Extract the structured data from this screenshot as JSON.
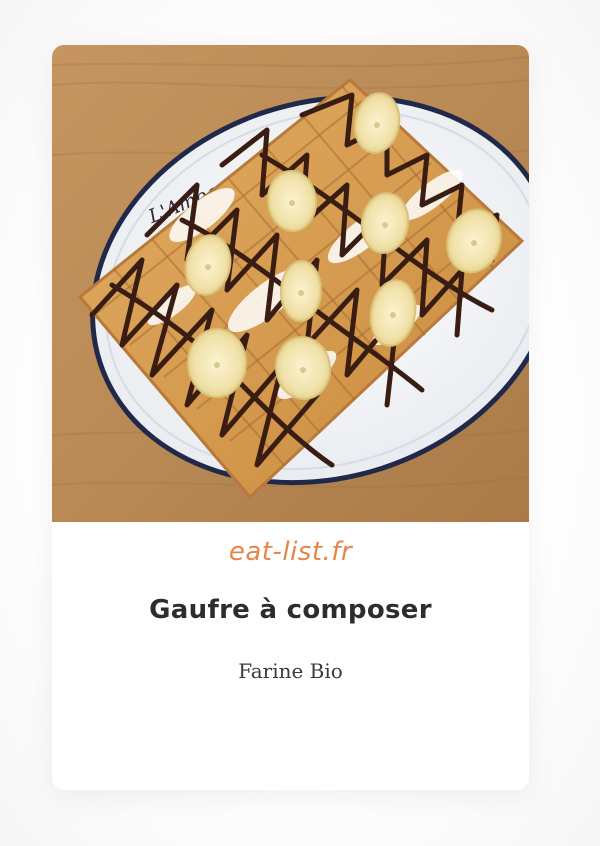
{
  "card": {
    "image_alt": "Gaufre à composer — waffle with banana slices, chocolate drizzle and powdered sugar",
    "plate_text": "L'Ambassade Bretonne",
    "watermark": "eat-list.fr",
    "title": "Gaufre à composer",
    "subtitle": "Farine Bio"
  },
  "colors": {
    "table_wood": "#b98a55",
    "plate": "#f1f3f6",
    "plate_rim": "#1f2a44",
    "waffle": "#d59a4c",
    "chocolate": "#3a1d12",
    "banana": "#f3e6b2",
    "watermark": "#e3702a",
    "title": "#2d2d2d"
  }
}
